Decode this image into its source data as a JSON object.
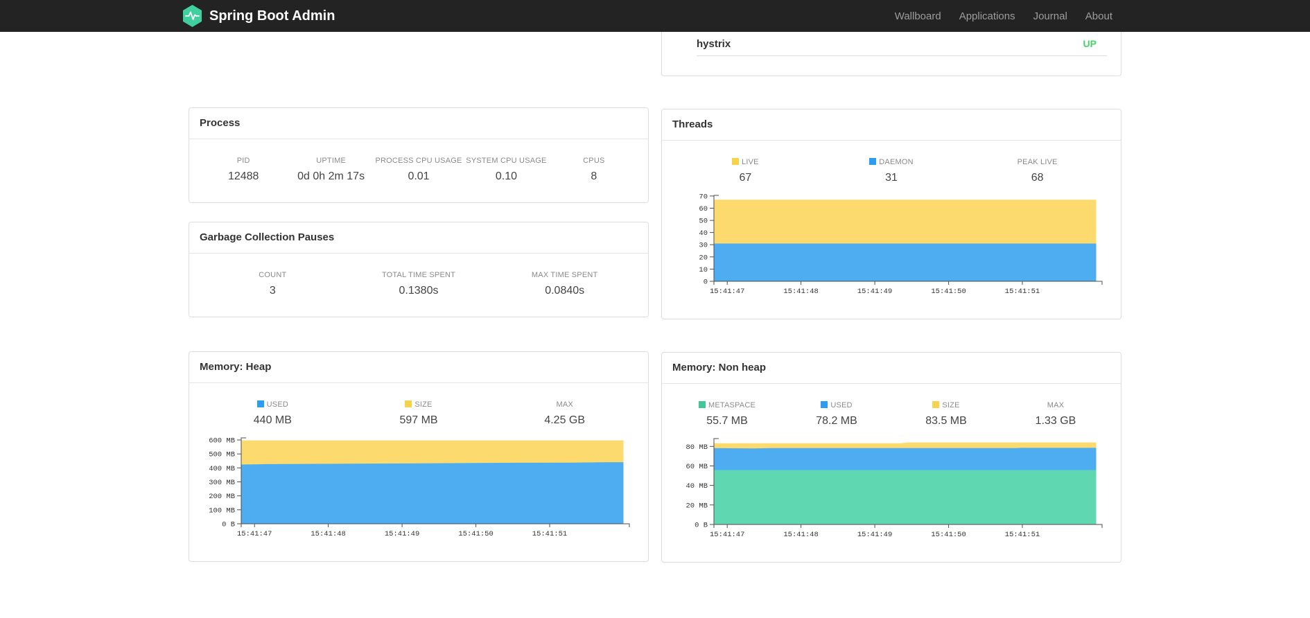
{
  "navbar": {
    "brand": "Spring Boot Admin",
    "links": [
      {
        "label": "Wallboard"
      },
      {
        "label": "Applications"
      },
      {
        "label": "Journal"
      },
      {
        "label": "About"
      }
    ]
  },
  "status_row": {
    "application": "hystrix",
    "status": "UP",
    "status_color": "#42d563"
  },
  "colors": {
    "logo_green": "#41cfa0",
    "area_yellow": "#FCDA6E",
    "area_blue": "#4DADF0",
    "area_green": "#5FD8B2",
    "legend_yellow": "#F7D34C",
    "legend_blue": "#2C9DF3",
    "legend_green": "#40C795"
  },
  "cards": {
    "process": {
      "title": "Process",
      "stats": [
        {
          "label": "PID",
          "value": "12488"
        },
        {
          "label": "UPTIME",
          "value": "0d 0h 2m 17s"
        },
        {
          "label": "PROCESS CPU USAGE",
          "value": "0.01"
        },
        {
          "label": "SYSTEM CPU USAGE",
          "value": "0.10"
        },
        {
          "label": "CPUS",
          "value": "8"
        }
      ]
    },
    "gc": {
      "title": "Garbage Collection Pauses",
      "stats": [
        {
          "label": "COUNT",
          "value": "3"
        },
        {
          "label": "TOTAL TIME SPENT",
          "value": "0.1380s"
        },
        {
          "label": "MAX TIME SPENT",
          "value": "0.0840s"
        }
      ]
    },
    "threads": {
      "title": "Threads",
      "stats": [
        {
          "label": "LIVE",
          "value": "67",
          "swatch": "#F7D34C"
        },
        {
          "label": "DAEMON",
          "value": "31",
          "swatch": "#2C9DF3"
        },
        {
          "label": "PEAK LIVE",
          "value": "68"
        }
      ],
      "chart_data": {
        "type": "area",
        "x_domain": [
          46.82,
          52.08
        ],
        "x_ticks": [
          {
            "v": 47,
            "label": "15:41:47"
          },
          {
            "v": 48,
            "label": "15:41:48"
          },
          {
            "v": 49,
            "label": "15:41:49"
          },
          {
            "v": 50,
            "label": "15:41:50"
          },
          {
            "v": 51,
            "label": "15:41:51"
          }
        ],
        "y_max": 70.5,
        "y_ticks": [
          {
            "v": 0,
            "label": "0"
          },
          {
            "v": 10,
            "label": "10"
          },
          {
            "v": 20,
            "label": "20"
          },
          {
            "v": 30,
            "label": "30"
          },
          {
            "v": 40,
            "label": "40"
          },
          {
            "v": 50,
            "label": "50"
          },
          {
            "v": 60,
            "label": "60"
          },
          {
            "v": 70,
            "label": "70"
          }
        ],
        "layers": [
          {
            "name": "live-total",
            "color": "#FCDA6E",
            "points": [
              [
                46.82,
                67
              ],
              [
                52.0,
                67
              ]
            ]
          },
          {
            "name": "daemon",
            "color": "#4DADF0",
            "points": [
              [
                46.82,
                31
              ],
              [
                52.0,
                31
              ]
            ]
          }
        ]
      }
    },
    "heap": {
      "title": "Memory: Heap",
      "stats": [
        {
          "label": "USED",
          "value": "440 MB",
          "swatch": "#2C9DF3"
        },
        {
          "label": "SIZE",
          "value": "597 MB",
          "swatch": "#F7D34C"
        },
        {
          "label": "MAX",
          "value": "4.25 GB"
        }
      ],
      "chart_data": {
        "type": "area",
        "x_domain": [
          46.82,
          52.08
        ],
        "x_ticks": [
          {
            "v": 47,
            "label": "15:41:47"
          },
          {
            "v": 48,
            "label": "15:41:48"
          },
          {
            "v": 49,
            "label": "15:41:49"
          },
          {
            "v": 50,
            "label": "15:41:50"
          },
          {
            "v": 51,
            "label": "15:41:51"
          }
        ],
        "y_max": 615,
        "y_ticks": [
          {
            "v": 0,
            "label": "0 B"
          },
          {
            "v": 100,
            "label": "100 MB"
          },
          {
            "v": 200,
            "label": "200 MB"
          },
          {
            "v": 300,
            "label": "300 MB"
          },
          {
            "v": 400,
            "label": "400 MB"
          },
          {
            "v": 500,
            "label": "500 MB"
          },
          {
            "v": 600,
            "label": "600 MB"
          }
        ],
        "layers": [
          {
            "name": "size",
            "color": "#FCDA6E",
            "points": [
              [
                46.82,
                597
              ],
              [
                52.0,
                597
              ]
            ]
          },
          {
            "name": "used",
            "color": "#4DADF0",
            "points": [
              [
                46.82,
                424
              ],
              [
                47.2,
                427
              ],
              [
                47.9,
                429
              ],
              [
                48.6,
                431
              ],
              [
                49.3,
                433
              ],
              [
                50.0,
                435
              ],
              [
                50.6,
                437
              ],
              [
                51.3,
                438
              ],
              [
                51.7,
                440
              ],
              [
                52.0,
                441
              ]
            ]
          }
        ]
      }
    },
    "nonheap": {
      "title": "Memory: Non heap",
      "stats": [
        {
          "label": "METASPACE",
          "value": "55.7 MB",
          "swatch": "#40C795"
        },
        {
          "label": "USED",
          "value": "78.2 MB",
          "swatch": "#2C9DF3"
        },
        {
          "label": "SIZE",
          "value": "83.5 MB",
          "swatch": "#F7D34C"
        },
        {
          "label": "MAX",
          "value": "1.33 GB"
        }
      ],
      "chart_data": {
        "type": "area",
        "x_domain": [
          46.82,
          52.08
        ],
        "x_ticks": [
          {
            "v": 47,
            "label": "15:41:47"
          },
          {
            "v": 48,
            "label": "15:41:48"
          },
          {
            "v": 49,
            "label": "15:41:49"
          },
          {
            "v": 50,
            "label": "15:41:50"
          },
          {
            "v": 51,
            "label": "15:41:51"
          }
        ],
        "y_max": 88,
        "y_ticks": [
          {
            "v": 0,
            "label": "0 B"
          },
          {
            "v": 20,
            "label": "20 MB"
          },
          {
            "v": 40,
            "label": "40 MB"
          },
          {
            "v": 60,
            "label": "60 MB"
          },
          {
            "v": 80,
            "label": "80 MB"
          }
        ],
        "layers": [
          {
            "name": "size",
            "color": "#FCDA6E",
            "points": [
              [
                46.82,
                83.2
              ],
              [
                49.35,
                83.2
              ],
              [
                49.45,
                84.0
              ],
              [
                52.0,
                84.0
              ]
            ]
          },
          {
            "name": "used",
            "color": "#4DADF0",
            "points": [
              [
                46.82,
                78.2
              ],
              [
                47.35,
                77.9
              ],
              [
                47.6,
                78.2
              ],
              [
                50.9,
                78.2
              ],
              [
                51.0,
                78.5
              ],
              [
                52.0,
                78.5
              ]
            ]
          },
          {
            "name": "metaspace",
            "color": "#5FD8B2",
            "points": [
              [
                46.82,
                55.7
              ],
              [
                52.0,
                55.7
              ]
            ]
          }
        ]
      }
    }
  }
}
